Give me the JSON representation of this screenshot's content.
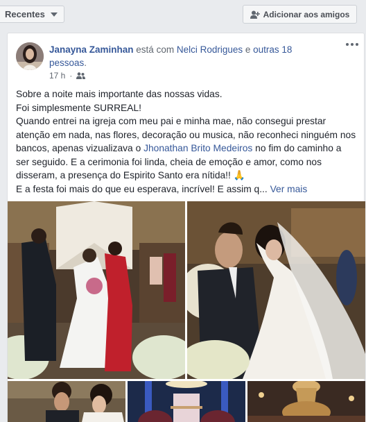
{
  "topbar": {
    "filter_label": "Recentes",
    "add_friends_label": "Adicionar aos amigos"
  },
  "post": {
    "author": "Janayna Zaminhan",
    "with_text": " está com ",
    "tagged": "Nelci Rodrigues",
    "and_text": " e ",
    "others": "outras 18 pessoas",
    "period": ".",
    "time": "17 h",
    "dot": "·",
    "lines": {
      "l1": "Sobre a noite mais importante das nossas vidas.",
      "l2": "Foi simplesmente SURREAL!",
      "l3a": "Quando entrei na igreja com meu pai e minha mae, não consegui prestar atenção em nada, nas flores, decoração ou musica, não reconheci ninguém nos bancos, apenas vizualizava o ",
      "mention": "Jhonathan Brito Medeiros",
      "l3b": " no fim do caminho a ser seguido. E a cerimonia foi linda, cheia de emoção e amor, como nos disseram, a presença do Espirito Santo era nítida!! 🙏",
      "l4": "E a festa foi mais do que eu esperava, incrível! E assim q...",
      "see_more": "Ver mais"
    }
  },
  "colors": {
    "link": "#365899",
    "text": "#1d2129",
    "meta": "#606770",
    "background": "#e9ebee"
  },
  "icons": {
    "caret": "chevron-down-icon",
    "add_friend": "add-friend-icon",
    "audience": "friends-icon",
    "more": "more-options-icon"
  }
}
